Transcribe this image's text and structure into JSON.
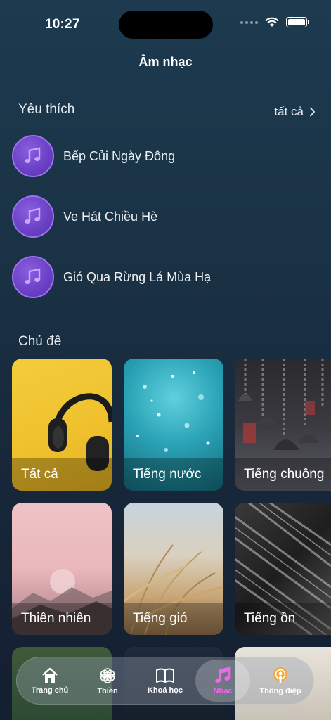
{
  "status": {
    "time": "10:27"
  },
  "header": {
    "title": "Âm nhạc"
  },
  "favorites": {
    "title": "Yêu thích",
    "see_all": "tất cả",
    "items": [
      {
        "label": "Bếp Củi Ngày Đông"
      },
      {
        "label": "Ve Hát Chiều Hè"
      },
      {
        "label": "Gió Qua Rừng Lá Mùa Hạ"
      }
    ]
  },
  "topics": {
    "title": "Chủ đề",
    "items": [
      {
        "label": "Tất cả"
      },
      {
        "label": "Tiếng nước"
      },
      {
        "label": "Tiếng chuông"
      },
      {
        "label": "Thiên nhiên"
      },
      {
        "label": "Tiếng gió"
      },
      {
        "label": "Tiếng ồn"
      }
    ]
  },
  "tabbar": {
    "items": [
      {
        "label": "Trang chủ",
        "icon": "home-icon"
      },
      {
        "label": "Thiền",
        "icon": "lotus-icon"
      },
      {
        "label": "Khoá học",
        "icon": "book-icon"
      },
      {
        "label": "Nhạc",
        "icon": "music-note-icon",
        "active": true
      },
      {
        "label": "Thông điệp",
        "icon": "podcast-icon"
      }
    ]
  },
  "colors": {
    "accent": "#e86be8",
    "fav_icon": "#6a3fc4"
  }
}
